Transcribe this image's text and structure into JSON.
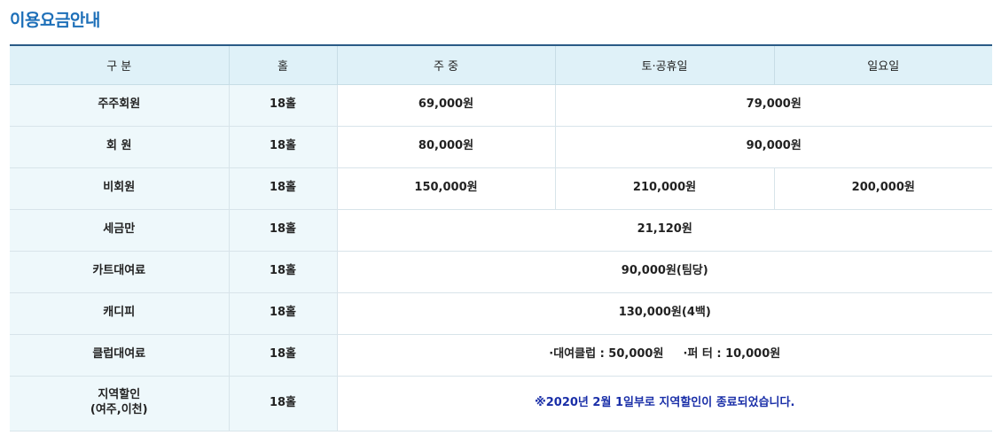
{
  "title": "이용요금안내",
  "headers": {
    "category": "구 분",
    "hole": "홀",
    "weekday": "주 중",
    "saturday_holiday": "토·공휴일",
    "sunday": "일요일"
  },
  "rows": [
    {
      "category": "주주회원",
      "hole": "18홀",
      "weekday": "69,000원",
      "weekend": "79,000원"
    },
    {
      "category": "회 원",
      "hole": "18홀",
      "weekday": "80,000원",
      "weekend": "90,000원"
    },
    {
      "category": "비회원",
      "hole": "18홀",
      "weekday": "150,000원",
      "saturday_holiday": "210,000원",
      "sunday": "200,000원"
    },
    {
      "category": "세금만",
      "hole": "18홀",
      "all": "21,120원"
    },
    {
      "category": "카트대여료",
      "hole": "18홀",
      "all": "90,000원(팀당)"
    },
    {
      "category": "캐디피",
      "hole": "18홀",
      "all": "130,000원(4백)"
    },
    {
      "category": "클럽대여료",
      "hole": "18홀",
      "club_rental": "·대여클럽 : 50,000원",
      "putter_rental": "·퍼 터 : 10,000원"
    },
    {
      "category_line1": "지역할인",
      "category_line2": "(여주,이천)",
      "hole": "18홀",
      "note": "※2020년 2월 1일부로 지역할인이 종료되었습니다."
    }
  ],
  "colors": {
    "title": "#1d6fb8",
    "header_bg": "#dff1f8",
    "category_bg": "#eef8fb",
    "header_top_border": "#2a5b86",
    "note_text": "#1a2fa8"
  }
}
